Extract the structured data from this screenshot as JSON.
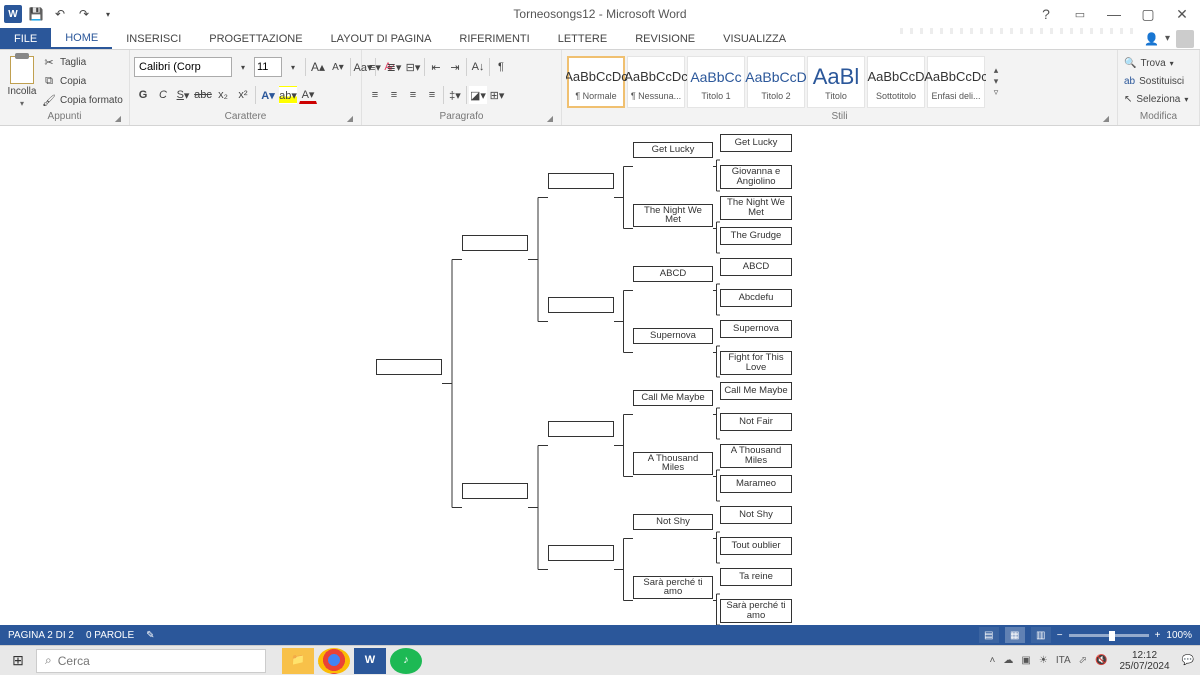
{
  "window": {
    "title": "Torneosongs12 - Microsoft Word"
  },
  "tabs": {
    "file": "FILE",
    "items": [
      "HOME",
      "INSERISCI",
      "PROGETTAZIONE",
      "LAYOUT DI PAGINA",
      "RIFERIMENTI",
      "LETTERE",
      "REVISIONE",
      "VISUALIZZA"
    ],
    "active": 0
  },
  "ribbon": {
    "clipboard": {
      "paste": "Incolla",
      "cut": "Taglia",
      "copy": "Copia",
      "formatPainter": "Copia formato",
      "label": "Appunti"
    },
    "font": {
      "name": "Calibri (Corp",
      "size": "11",
      "label": "Carattere"
    },
    "paragraph": {
      "label": "Paragrafo"
    },
    "styles": {
      "label": "Stili",
      "items": [
        {
          "preview": "AaBbCcDc",
          "name": "¶ Normale",
          "cls": ""
        },
        {
          "preview": "AaBbCcDc",
          "name": "¶ Nessuna...",
          "cls": ""
        },
        {
          "preview": "AaBbCc",
          "name": "Titolo 1",
          "cls": "heading"
        },
        {
          "preview": "AaBbCcD",
          "name": "Titolo 2",
          "cls": "heading"
        },
        {
          "preview": "AaBl",
          "name": "Titolo",
          "cls": "title"
        },
        {
          "preview": "AaBbCcD",
          "name": "Sottotitolo",
          "cls": ""
        },
        {
          "preview": "AaBbCcDc",
          "name": "Enfasi deli...",
          "cls": ""
        }
      ]
    },
    "editing": {
      "find": "Trova",
      "replace": "Sostituisci",
      "select": "Seleziona",
      "label": "Modifica"
    }
  },
  "bracket": {
    "r32": [
      "Get Lucky",
      "Giovanna e Angiolino",
      "The Night We Met",
      "The Grudge",
      "ABCD",
      "Abcdefu",
      "Supernova",
      "Fight for This Love",
      "Call Me Maybe",
      "Not Fair",
      "A Thousand Miles",
      "Marameo",
      "Not Shy",
      "Tout oublier",
      "Ta reine",
      "Sarà perché ti amo"
    ],
    "r16": [
      "Get Lucky",
      "The Night We Met",
      "ABCD",
      "Supernova",
      "Call Me Maybe",
      "A Thousand Miles",
      "Not Shy",
      "Sarà perché ti amo"
    ],
    "r8": [
      "",
      "",
      "",
      ""
    ],
    "r4": [
      "",
      ""
    ],
    "r2": [
      ""
    ]
  },
  "status": {
    "page": "PAGINA 2 DI 2",
    "words": "0 PAROLE",
    "zoom": "100%"
  },
  "taskbar": {
    "search": "Cerca",
    "time": "12:12",
    "date": "25/07/2024"
  }
}
